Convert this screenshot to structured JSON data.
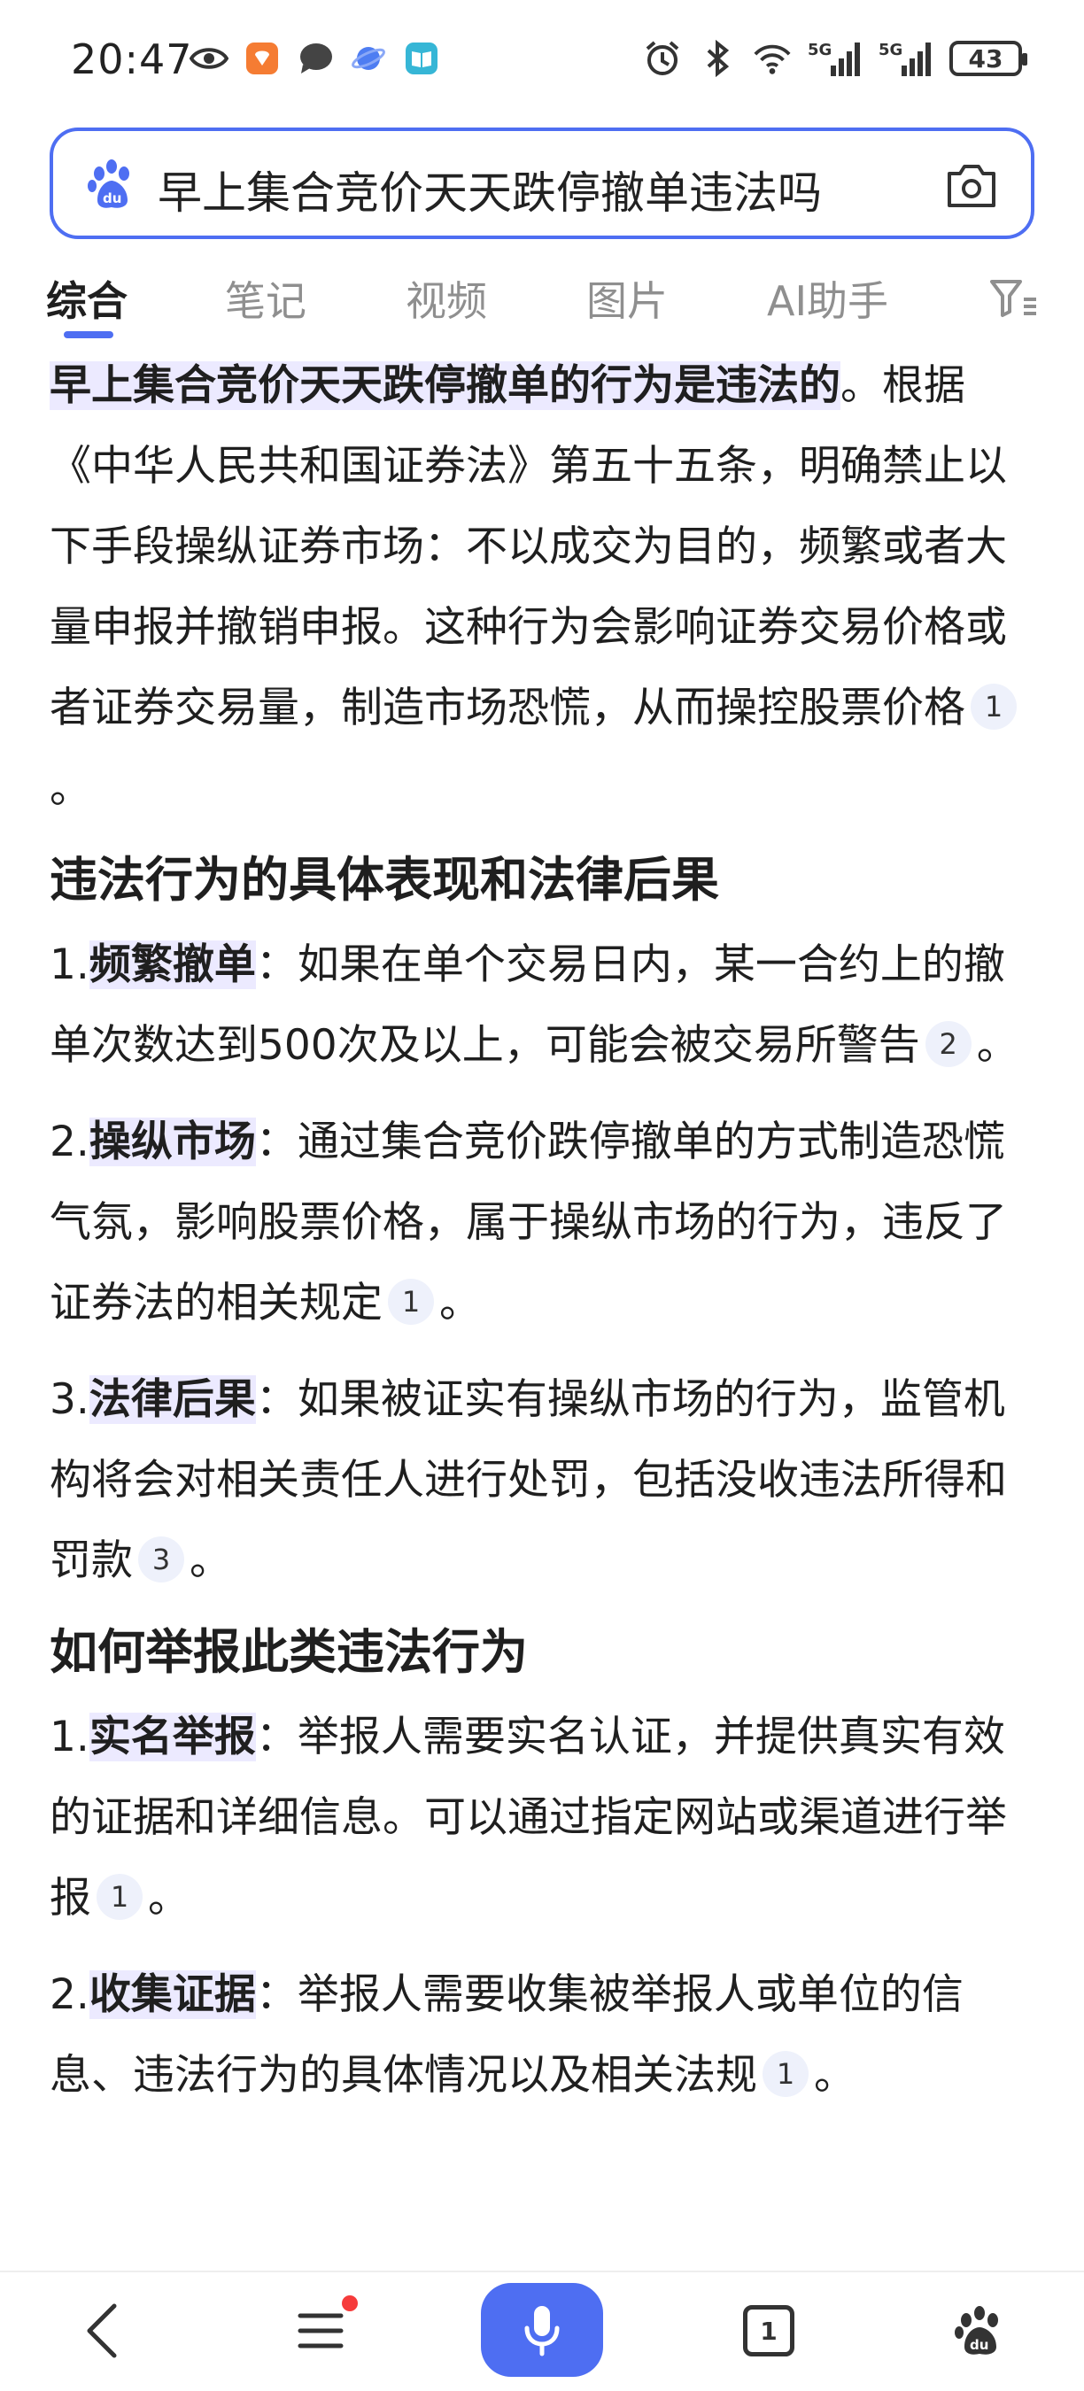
{
  "status_bar": {
    "time": "20:47",
    "battery": "43",
    "network_1": "5G",
    "network_2": "5G"
  },
  "search": {
    "query": "早上集合竞价天天跌停撤单违法吗"
  },
  "tabs": [
    {
      "label": "综合",
      "active": true
    },
    {
      "label": "笔记",
      "active": false
    },
    {
      "label": "视频",
      "active": false
    },
    {
      "label": "图片",
      "active": false
    },
    {
      "label": "AI助手",
      "active": false
    }
  ],
  "answer": {
    "intro_highlight": "早上集合竞价天天跌停撤单的行为是违法的",
    "intro_rest": "。根据《中华人民共和国证券法》第五十五条，明确禁止以下手段操纵证券市场：不以成交为目的，频繁或者大量申报并撤销申报。这种行为会影响证券交易价格或者证券交易量，制造市场恐慌，从而操控股票价格",
    "intro_cite": "1",
    "section1_title": "违法行为的具体表现和法律后果",
    "section1_items": [
      {
        "num": "1.",
        "term": "频繁撤单",
        "text": "：如果在单个交易日内，某一合约上的撤单次数达到500次及以上，可能会被交易所警告",
        "cite": "2"
      },
      {
        "num": "2.",
        "term": "操纵市场",
        "text": "：通过集合竞价跌停撤单的方式制造恐慌气氛，影响股票价格，属于操纵市场的行为，违反了证券法的相关规定",
        "cite": "1"
      },
      {
        "num": "3.",
        "term": "法律后果",
        "text": "：如果被证实有操纵市场的行为，监管机构将会对相关责任人进行处罚，包括没收违法所得和罚款",
        "cite": "3"
      }
    ],
    "section2_title": "如何举报此类违法行为",
    "section2_items": [
      {
        "num": "1.",
        "term": "实名举报",
        "text": "：举报人需要实名认证，并提供真实有效的证据和详细信息。可以通过指定网站或渠道进行举报",
        "cite": "1"
      },
      {
        "num": "2.",
        "term": "收集证据",
        "text": "：举报人需要收集被举报人或单位的信息、违法行为的具体情况以及相关法规",
        "cite": "1"
      }
    ],
    "period": "。"
  },
  "bottom_nav": {
    "tab_count": "1"
  },
  "colors": {
    "accent": "#4e6ef2",
    "highlight": "#eceaff",
    "notification": "#f63b3b"
  }
}
